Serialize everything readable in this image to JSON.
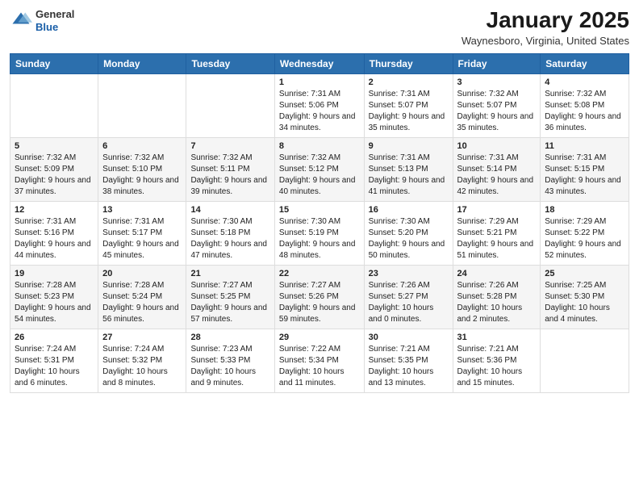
{
  "header": {
    "logo_line1": "General",
    "logo_line2": "Blue",
    "title": "January 2025",
    "subtitle": "Waynesboro, Virginia, United States"
  },
  "days_of_week": [
    "Sunday",
    "Monday",
    "Tuesday",
    "Wednesday",
    "Thursday",
    "Friday",
    "Saturday"
  ],
  "weeks": [
    [
      {
        "day": "",
        "sunrise": "",
        "sunset": "",
        "daylight": ""
      },
      {
        "day": "",
        "sunrise": "",
        "sunset": "",
        "daylight": ""
      },
      {
        "day": "",
        "sunrise": "",
        "sunset": "",
        "daylight": ""
      },
      {
        "day": "1",
        "sunrise": "Sunrise: 7:31 AM",
        "sunset": "Sunset: 5:06 PM",
        "daylight": "Daylight: 9 hours and 34 minutes."
      },
      {
        "day": "2",
        "sunrise": "Sunrise: 7:31 AM",
        "sunset": "Sunset: 5:07 PM",
        "daylight": "Daylight: 9 hours and 35 minutes."
      },
      {
        "day": "3",
        "sunrise": "Sunrise: 7:32 AM",
        "sunset": "Sunset: 5:07 PM",
        "daylight": "Daylight: 9 hours and 35 minutes."
      },
      {
        "day": "4",
        "sunrise": "Sunrise: 7:32 AM",
        "sunset": "Sunset: 5:08 PM",
        "daylight": "Daylight: 9 hours and 36 minutes."
      }
    ],
    [
      {
        "day": "5",
        "sunrise": "Sunrise: 7:32 AM",
        "sunset": "Sunset: 5:09 PM",
        "daylight": "Daylight: 9 hours and 37 minutes."
      },
      {
        "day": "6",
        "sunrise": "Sunrise: 7:32 AM",
        "sunset": "Sunset: 5:10 PM",
        "daylight": "Daylight: 9 hours and 38 minutes."
      },
      {
        "day": "7",
        "sunrise": "Sunrise: 7:32 AM",
        "sunset": "Sunset: 5:11 PM",
        "daylight": "Daylight: 9 hours and 39 minutes."
      },
      {
        "day": "8",
        "sunrise": "Sunrise: 7:32 AM",
        "sunset": "Sunset: 5:12 PM",
        "daylight": "Daylight: 9 hours and 40 minutes."
      },
      {
        "day": "9",
        "sunrise": "Sunrise: 7:31 AM",
        "sunset": "Sunset: 5:13 PM",
        "daylight": "Daylight: 9 hours and 41 minutes."
      },
      {
        "day": "10",
        "sunrise": "Sunrise: 7:31 AM",
        "sunset": "Sunset: 5:14 PM",
        "daylight": "Daylight: 9 hours and 42 minutes."
      },
      {
        "day": "11",
        "sunrise": "Sunrise: 7:31 AM",
        "sunset": "Sunset: 5:15 PM",
        "daylight": "Daylight: 9 hours and 43 minutes."
      }
    ],
    [
      {
        "day": "12",
        "sunrise": "Sunrise: 7:31 AM",
        "sunset": "Sunset: 5:16 PM",
        "daylight": "Daylight: 9 hours and 44 minutes."
      },
      {
        "day": "13",
        "sunrise": "Sunrise: 7:31 AM",
        "sunset": "Sunset: 5:17 PM",
        "daylight": "Daylight: 9 hours and 45 minutes."
      },
      {
        "day": "14",
        "sunrise": "Sunrise: 7:30 AM",
        "sunset": "Sunset: 5:18 PM",
        "daylight": "Daylight: 9 hours and 47 minutes."
      },
      {
        "day": "15",
        "sunrise": "Sunrise: 7:30 AM",
        "sunset": "Sunset: 5:19 PM",
        "daylight": "Daylight: 9 hours and 48 minutes."
      },
      {
        "day": "16",
        "sunrise": "Sunrise: 7:30 AM",
        "sunset": "Sunset: 5:20 PM",
        "daylight": "Daylight: 9 hours and 50 minutes."
      },
      {
        "day": "17",
        "sunrise": "Sunrise: 7:29 AM",
        "sunset": "Sunset: 5:21 PM",
        "daylight": "Daylight: 9 hours and 51 minutes."
      },
      {
        "day": "18",
        "sunrise": "Sunrise: 7:29 AM",
        "sunset": "Sunset: 5:22 PM",
        "daylight": "Daylight: 9 hours and 52 minutes."
      }
    ],
    [
      {
        "day": "19",
        "sunrise": "Sunrise: 7:28 AM",
        "sunset": "Sunset: 5:23 PM",
        "daylight": "Daylight: 9 hours and 54 minutes."
      },
      {
        "day": "20",
        "sunrise": "Sunrise: 7:28 AM",
        "sunset": "Sunset: 5:24 PM",
        "daylight": "Daylight: 9 hours and 56 minutes."
      },
      {
        "day": "21",
        "sunrise": "Sunrise: 7:27 AM",
        "sunset": "Sunset: 5:25 PM",
        "daylight": "Daylight: 9 hours and 57 minutes."
      },
      {
        "day": "22",
        "sunrise": "Sunrise: 7:27 AM",
        "sunset": "Sunset: 5:26 PM",
        "daylight": "Daylight: 9 hours and 59 minutes."
      },
      {
        "day": "23",
        "sunrise": "Sunrise: 7:26 AM",
        "sunset": "Sunset: 5:27 PM",
        "daylight": "Daylight: 10 hours and 0 minutes."
      },
      {
        "day": "24",
        "sunrise": "Sunrise: 7:26 AM",
        "sunset": "Sunset: 5:28 PM",
        "daylight": "Daylight: 10 hours and 2 minutes."
      },
      {
        "day": "25",
        "sunrise": "Sunrise: 7:25 AM",
        "sunset": "Sunset: 5:30 PM",
        "daylight": "Daylight: 10 hours and 4 minutes."
      }
    ],
    [
      {
        "day": "26",
        "sunrise": "Sunrise: 7:24 AM",
        "sunset": "Sunset: 5:31 PM",
        "daylight": "Daylight: 10 hours and 6 minutes."
      },
      {
        "day": "27",
        "sunrise": "Sunrise: 7:24 AM",
        "sunset": "Sunset: 5:32 PM",
        "daylight": "Daylight: 10 hours and 8 minutes."
      },
      {
        "day": "28",
        "sunrise": "Sunrise: 7:23 AM",
        "sunset": "Sunset: 5:33 PM",
        "daylight": "Daylight: 10 hours and 9 minutes."
      },
      {
        "day": "29",
        "sunrise": "Sunrise: 7:22 AM",
        "sunset": "Sunset: 5:34 PM",
        "daylight": "Daylight: 10 hours and 11 minutes."
      },
      {
        "day": "30",
        "sunrise": "Sunrise: 7:21 AM",
        "sunset": "Sunset: 5:35 PM",
        "daylight": "Daylight: 10 hours and 13 minutes."
      },
      {
        "day": "31",
        "sunrise": "Sunrise: 7:21 AM",
        "sunset": "Sunset: 5:36 PM",
        "daylight": "Daylight: 10 hours and 15 minutes."
      },
      {
        "day": "",
        "sunrise": "",
        "sunset": "",
        "daylight": ""
      }
    ]
  ]
}
